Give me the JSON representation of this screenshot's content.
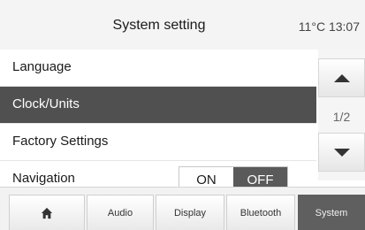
{
  "header": {
    "title": "System setting",
    "temperature": "11",
    "temp_unit": "°C",
    "time": "13:07"
  },
  "menu": {
    "items": [
      {
        "label": "Language"
      },
      {
        "label": "Clock/Units"
      },
      {
        "label": "Factory Settings"
      },
      {
        "label": "Navigation"
      }
    ],
    "navigation_toggle": {
      "on_label": "ON",
      "off_label": "OFF",
      "selected": "OFF"
    }
  },
  "scroll": {
    "page_indicator": "1/2"
  },
  "tabs": [
    {
      "icon": "home-icon"
    },
    {
      "label": "Audio"
    },
    {
      "label": "Display"
    },
    {
      "label": "Bluetooth"
    },
    {
      "label": "System"
    }
  ],
  "colors": {
    "selected_row": "#505050",
    "active_tab": "#5f5f5f",
    "toggle_off_selected": "#5a5a5a"
  }
}
